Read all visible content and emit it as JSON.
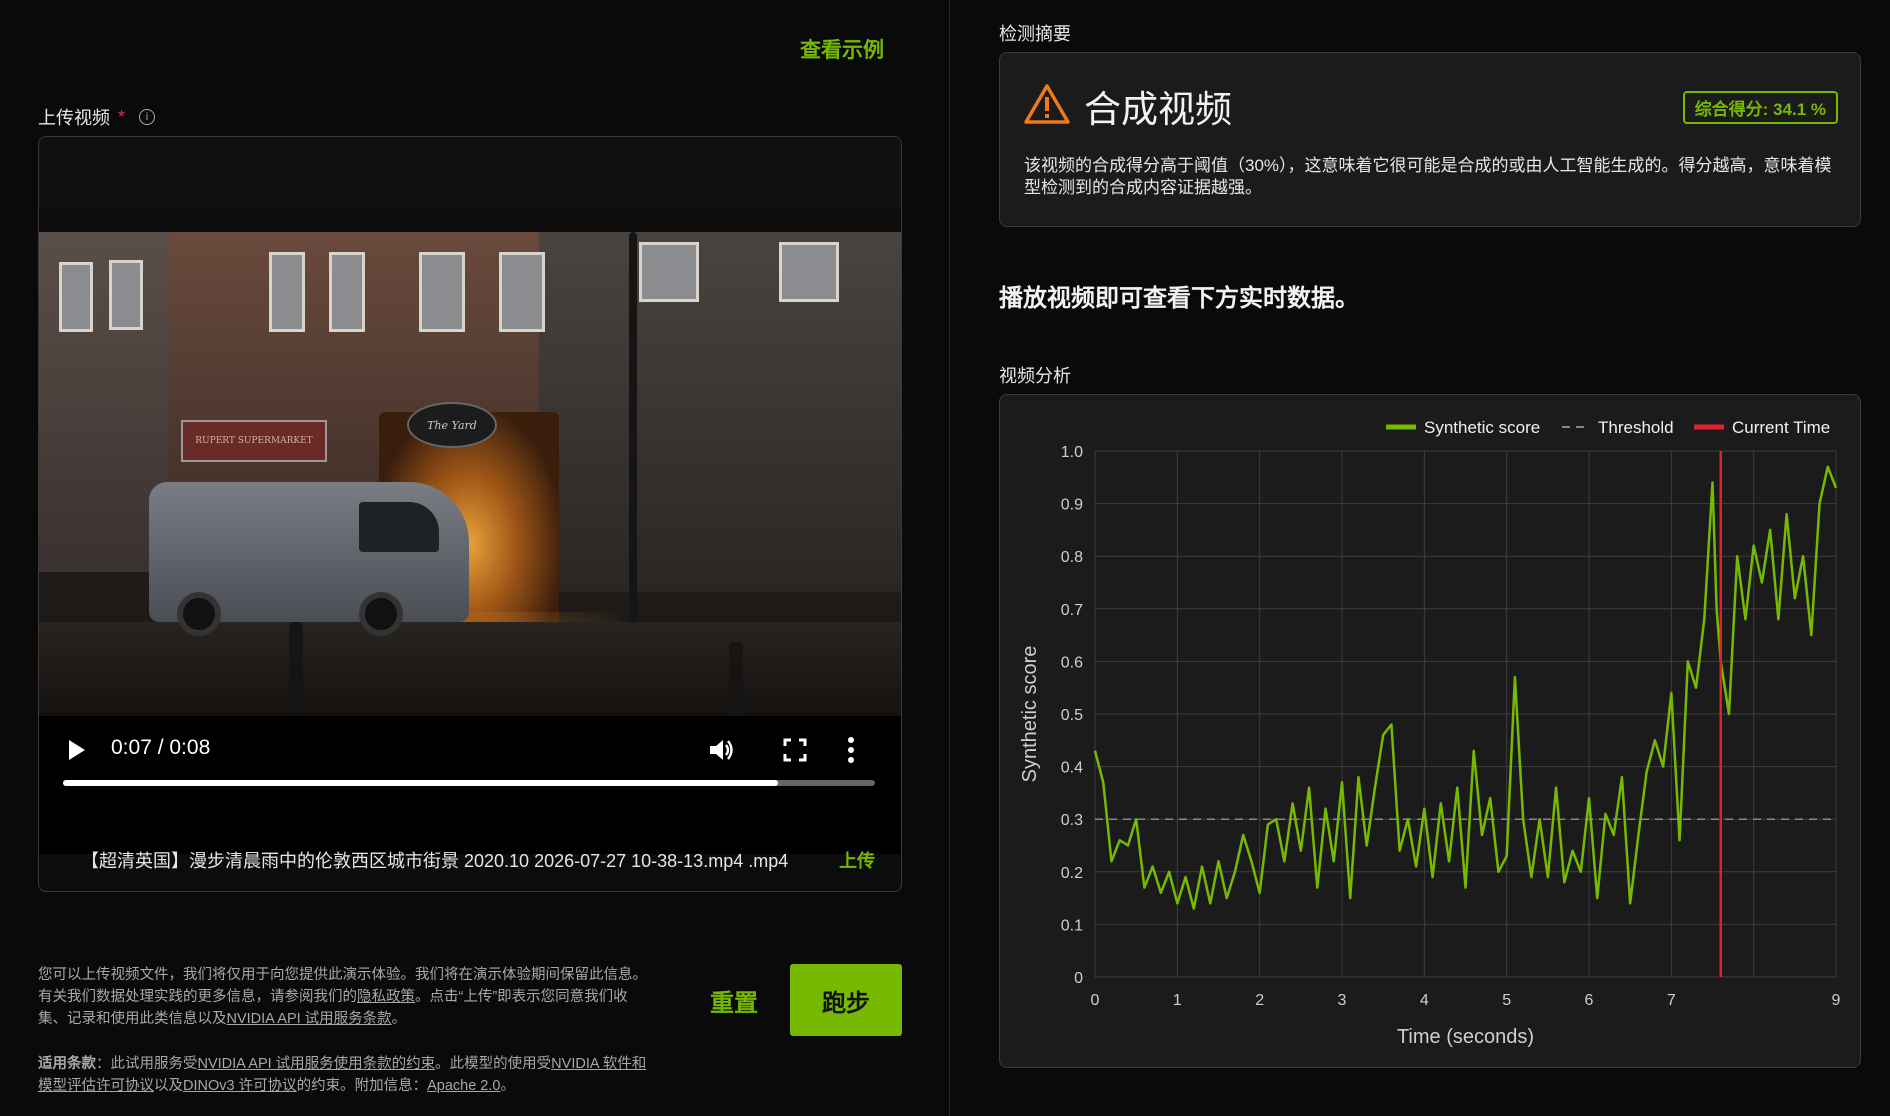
{
  "left": {
    "view_example": "查看示例",
    "upload_label": "上传视频",
    "required_mark": "*",
    "info_icon": "info-icon",
    "video": {
      "current_time": "0:07 / 0:08",
      "progress_fraction": 0.88,
      "scene_text": {
        "van_sign": "RUPERT SUPERMARKET",
        "bar_sign": "The Yard"
      }
    },
    "file_name": "【超清英国】漫步清晨雨中的伦敦西区城市街景 2020.10 2026-07-27 10-38-13.mp4   .mp4",
    "upload_link": "上传",
    "disclaimer": {
      "p1": "您可以上传视频文件，我们将仅用于向您提供此演示体验。我们将在演示体验期间保留此信息。有关我们数据处理实践的更多信息，请参阅我们的",
      "privacy_link": "隐私政策",
      "p2": "。点击“上传”即表示您同意我们收集、记录和使用此类信息以及",
      "api_terms_link": "NVIDIA API 试用服务条款",
      "p3": "。"
    },
    "terms": {
      "label": "适用条款",
      "t1": "：此试用服务受",
      "link1": "NVIDIA API 试用服务使用条款的约束",
      "t2": "。此模型的使用受",
      "link2": "NVIDIA 软件和模型评估许可协议",
      "t3": "以及",
      "link3": "DINOv3 许可协议",
      "t4": "的约束。附加信息：",
      "link4": "Apache 2.0",
      "t5": "。"
    },
    "reset_button": "重置",
    "run_button": "跑步"
  },
  "right": {
    "summary_title": "检测摘要",
    "result_label": "合成视频",
    "score_badge": "综合得分:   34.1 %",
    "summary_text": "该视频的合成得分高于阈值（30%），这意味着它很可能是合成的或由人工智能生成的。得分越高，意味着模型检测到的合成内容证据越强。",
    "play_hint": "播放视频即可查看下方实时数据。",
    "analysis_title": "视频分析"
  },
  "colors": {
    "accent": "#76b900",
    "threshold": "#888888",
    "current_time": "#e0202a",
    "card_bg": "#1b1b1b"
  },
  "chart_data": {
    "type": "line",
    "xlabel": "Time (seconds)",
    "ylabel": "Synthetic score",
    "xlim": [
      0,
      9
    ],
    "ylim": [
      0,
      1.0
    ],
    "x_ticks": [
      0,
      1,
      2,
      3,
      4,
      5,
      6,
      7,
      8,
      9
    ],
    "x_tick_labels": [
      "0",
      "1",
      "2",
      "3",
      "4",
      "5",
      "6",
      "7",
      "",
      "9"
    ],
    "y_ticks": [
      0,
      0.1,
      0.2,
      0.3,
      0.4,
      0.5,
      0.6,
      0.7,
      0.8,
      0.9,
      1.0
    ],
    "y_tick_labels": [
      "0",
      "0.1",
      "0.2",
      "0.3",
      "0.4",
      "0.5",
      "0.6",
      "0.7",
      "0.8",
      "0.9",
      "1.0"
    ],
    "grid": true,
    "legend_position": "top-right",
    "threshold": 0.3,
    "current_time": 7.6,
    "series": [
      {
        "name": "Synthetic score",
        "color": "#76b900",
        "x": [
          0,
          0.1,
          0.2,
          0.3,
          0.4,
          0.5,
          0.6,
          0.7,
          0.8,
          0.9,
          1.0,
          1.1,
          1.2,
          1.3,
          1.4,
          1.5,
          1.6,
          1.7,
          1.8,
          1.9,
          2.0,
          2.1,
          2.2,
          2.3,
          2.4,
          2.5,
          2.6,
          2.7,
          2.8,
          2.9,
          3.0,
          3.1,
          3.2,
          3.3,
          3.4,
          3.5,
          3.6,
          3.7,
          3.8,
          3.9,
          4.0,
          4.1,
          4.2,
          4.3,
          4.4,
          4.5,
          4.6,
          4.7,
          4.8,
          4.9,
          5.0,
          5.1,
          5.2,
          5.3,
          5.4,
          5.5,
          5.6,
          5.7,
          5.8,
          5.9,
          6.0,
          6.1,
          6.2,
          6.3,
          6.4,
          6.5,
          6.6,
          6.7,
          6.8,
          6.9,
          7.0,
          7.1,
          7.2,
          7.3,
          7.4,
          7.5,
          7.55,
          7.6,
          7.7,
          7.8,
          7.9,
          8.0,
          8.1,
          8.2,
          8.3,
          8.4,
          8.5,
          8.6,
          8.7,
          8.8,
          8.9,
          9.0
        ],
        "values": [
          0.43,
          0.37,
          0.22,
          0.26,
          0.25,
          0.3,
          0.17,
          0.21,
          0.16,
          0.2,
          0.14,
          0.19,
          0.13,
          0.21,
          0.14,
          0.22,
          0.15,
          0.2,
          0.27,
          0.22,
          0.16,
          0.29,
          0.3,
          0.22,
          0.33,
          0.24,
          0.36,
          0.17,
          0.32,
          0.22,
          0.37,
          0.15,
          0.38,
          0.25,
          0.36,
          0.46,
          0.48,
          0.24,
          0.3,
          0.21,
          0.32,
          0.19,
          0.33,
          0.22,
          0.36,
          0.17,
          0.43,
          0.27,
          0.34,
          0.2,
          0.23,
          0.57,
          0.3,
          0.19,
          0.3,
          0.19,
          0.36,
          0.18,
          0.24,
          0.2,
          0.34,
          0.15,
          0.31,
          0.27,
          0.38,
          0.14,
          0.27,
          0.39,
          0.45,
          0.4,
          0.54,
          0.26,
          0.6,
          0.55,
          0.68,
          0.94,
          0.7,
          0.6,
          0.5,
          0.8,
          0.68,
          0.82,
          0.75,
          0.85,
          0.68,
          0.88,
          0.72,
          0.8,
          0.65,
          0.9,
          0.97,
          0.93
        ]
      },
      {
        "name": "Threshold",
        "color": "#888888",
        "dashed": true
      },
      {
        "name": "Current Time",
        "color": "#e0202a"
      }
    ]
  }
}
